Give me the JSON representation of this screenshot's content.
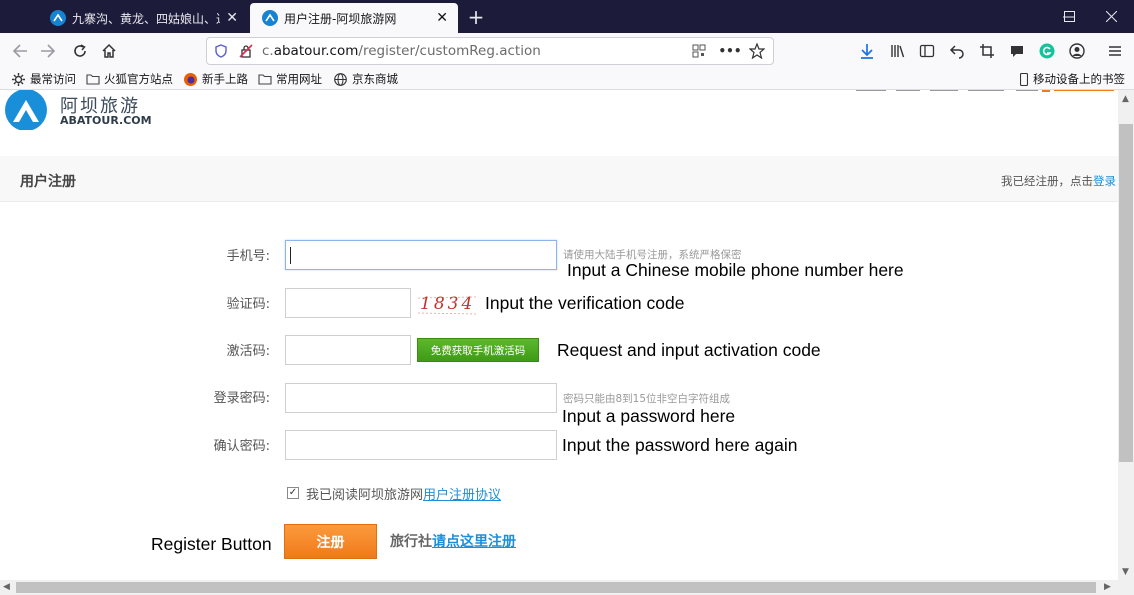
{
  "tabs": [
    {
      "title": "九寨沟、黄龙、四姑娘山、达古"
    },
    {
      "title": "用户注册-阿坝旅游网"
    }
  ],
  "address_bar": {
    "url_prefix": "c.",
    "url_domain": "abatour.com",
    "url_path": "/register/customReg.action"
  },
  "bookmarks": [
    {
      "label": "最常访问",
      "icon": "gear-icon"
    },
    {
      "label": "火狐官方站点",
      "icon": "folder-icon"
    },
    {
      "label": "新手上路",
      "icon": "firefox-icon"
    },
    {
      "label": "常用网址",
      "icon": "folder-icon"
    },
    {
      "label": "京东商城",
      "icon": "globe-icon"
    },
    {
      "label": "移动设备上的书签",
      "icon": "mobile-icon"
    }
  ],
  "site": {
    "logo_cn": "阿坝旅游",
    "logo_en": "ABATOUR.COM"
  },
  "header": {
    "title": "用户注册",
    "already_registered": "我已经注册，点击",
    "login_link": "登录"
  },
  "form": {
    "phone": {
      "label": "手机号:",
      "value": "",
      "hint": "请使用大陆手机号注册，系统严格保密"
    },
    "captcha": {
      "label": "验证码:",
      "value": "",
      "image_text": "1834"
    },
    "activation": {
      "label": "激活码:",
      "value": "",
      "button": "免费获取手机激活码"
    },
    "password": {
      "label": "登录密码:",
      "value": "",
      "hint": "密码只能由8到15位非空白字符组成"
    },
    "confirm_password": {
      "label": "确认密码:",
      "value": ""
    },
    "agreement": {
      "checked": true,
      "text": "我已阅读阿坝旅游网",
      "link": "用户注册协议"
    },
    "register_button": "注册",
    "agency_prefix": "旅行社",
    "agency_link": "请点这里注册"
  },
  "annotations": {
    "phone": "Input a Chinese mobile phone number here",
    "captcha": "Input the verification code",
    "activation": "Request and input activation code",
    "password": "Input a password here",
    "confirm": "Input the password here again",
    "register": "Register Button"
  },
  "colors": {
    "tabbar": "#1c1b3a",
    "link": "#1e8fd6",
    "register_button": "#f5841f",
    "sms_button": "#4aa81f"
  }
}
